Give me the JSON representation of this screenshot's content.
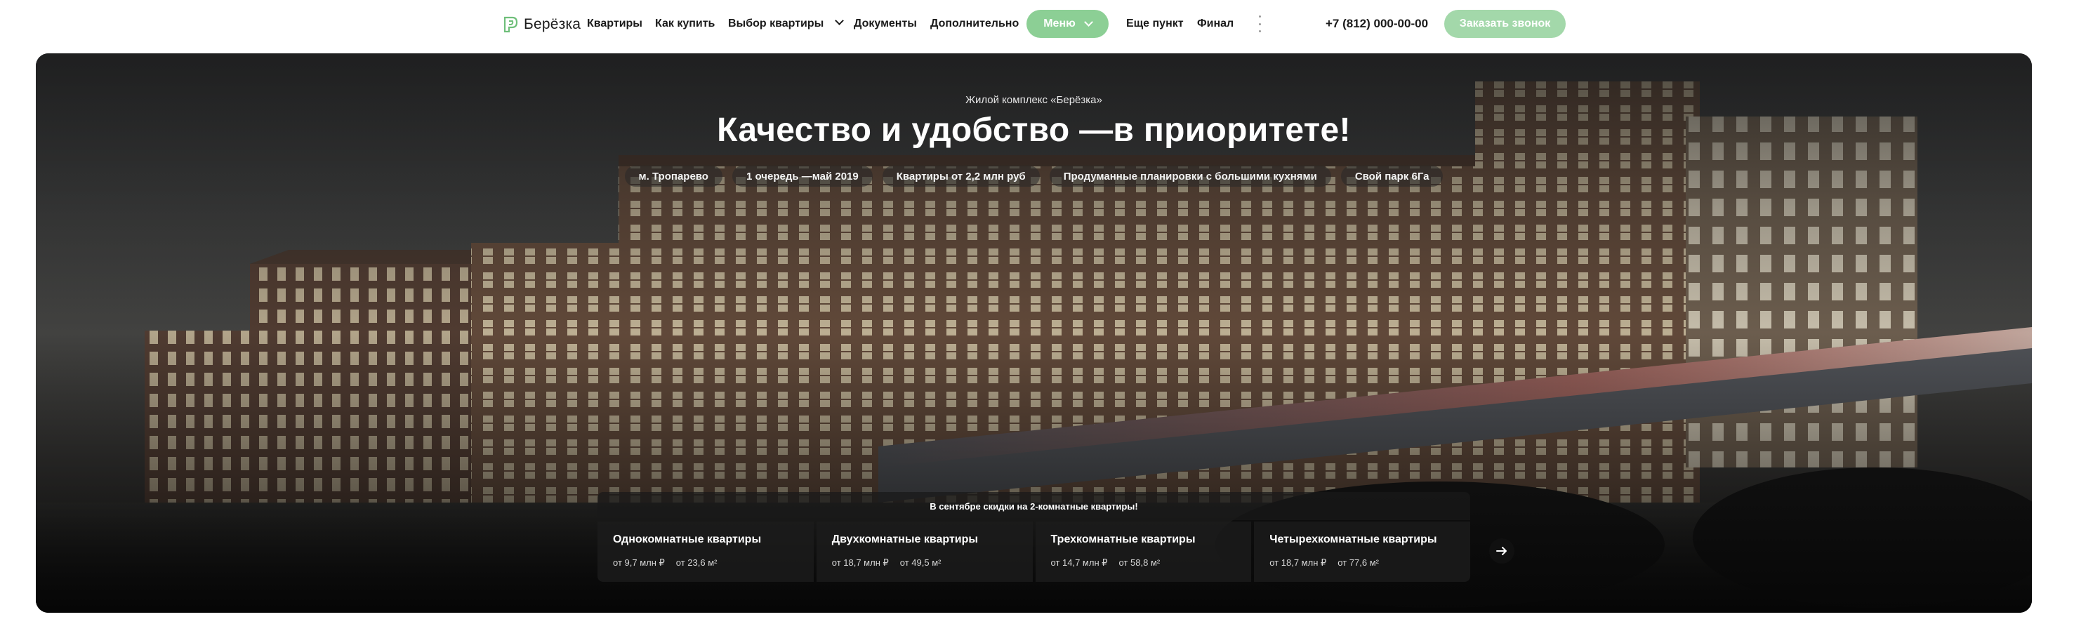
{
  "header": {
    "logo_text": "Берёзка",
    "nav": [
      "Квартиры",
      "Как купить",
      "Выбор квартиры",
      "Документы",
      "Дополнительно"
    ],
    "menu_label": "Меню",
    "nav_extra": [
      "Еще пункт",
      "Финал"
    ],
    "phone": "+7 (812) 000-00-00",
    "call_button": "Заказать звонок"
  },
  "hero": {
    "eyebrow": "Жилой комплекс «Берёзка»",
    "title": "Качество и удобство —в приоритете!",
    "chips": [
      "м. Тропарево",
      "1 очередь —май 2019",
      "Квартиры от 2,2 млн руб",
      "Продуманные планировки с большими кухнями",
      "Свой парк 6Га"
    ],
    "promo": "В сентябре скидки на 2-комнатные квартиры!",
    "cards": [
      {
        "title": "Однокомнатные квартиры",
        "price": "от 9,7 млн ₽",
        "area": "от 23,6 м²"
      },
      {
        "title": "Двухкомнатные квартиры",
        "price": "от 18,7 млн ₽",
        "area": "от 49,5 м²"
      },
      {
        "title": "Трехкомнатные квартиры",
        "price": "от 14,7 млн ₽",
        "area": "от 58,8 м²"
      },
      {
        "title": "Четырехкомнатные квартиры",
        "price": "от 18,7 млн ₽",
        "area": "от 77,6 м²"
      }
    ]
  },
  "colors": {
    "accent": "#8ccf95",
    "accent_light": "#a3d8aa",
    "text": "#1b1b1b"
  },
  "icons": [
    "leaf-logo-icon",
    "chevron-down-icon",
    "more-vertical-icon",
    "arrow-right-icon"
  ]
}
